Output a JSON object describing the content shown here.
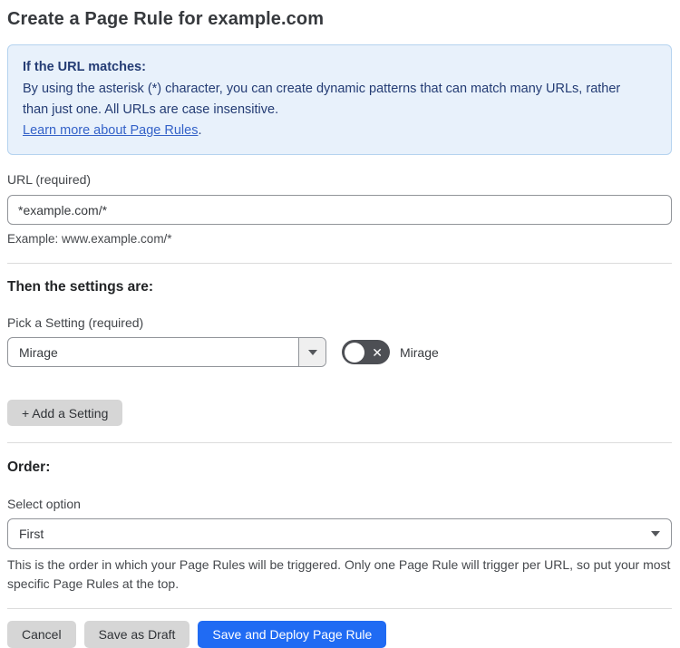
{
  "page": {
    "title": "Create a Page Rule for example.com"
  },
  "info_box": {
    "heading": "If the URL matches:",
    "body": "By using the asterisk (*) character, you can create dynamic patterns that can match many URLs, rather than just one. All URLs are case insensitive.",
    "link_label": "Learn more about Page Rules",
    "link_suffix": "."
  },
  "url_field": {
    "label": "URL (required)",
    "value": "*example.com/*",
    "helper": "Example: www.example.com/*"
  },
  "settings_section": {
    "heading": "Then the settings are:",
    "picker_label": "Pick a Setting (required)",
    "picker_value": "Mirage",
    "toggle_state": "off",
    "toggle_glyph": "✕",
    "toggle_label": "Mirage",
    "add_button_label": "+ Add a Setting"
  },
  "order_section": {
    "heading": "Order:",
    "select_label": "Select option",
    "select_value": "First",
    "helper": "This is the order in which your Page Rules will be triggered. Only one Page Rule will trigger per URL, so put your most specific Page Rules at the top."
  },
  "footer": {
    "cancel_label": "Cancel",
    "save_draft_label": "Save as Draft",
    "save_deploy_label": "Save and Deploy Page Rule"
  },
  "colors": {
    "info_background": "#e8f1fb",
    "info_border": "#b5d3ef",
    "info_text": "#243c74",
    "link_blue": "#3462c8",
    "primary_button_blue": "#206bf3",
    "gray_button": "#d6d6d6",
    "toggle_off_gray": "#4d4f54"
  }
}
